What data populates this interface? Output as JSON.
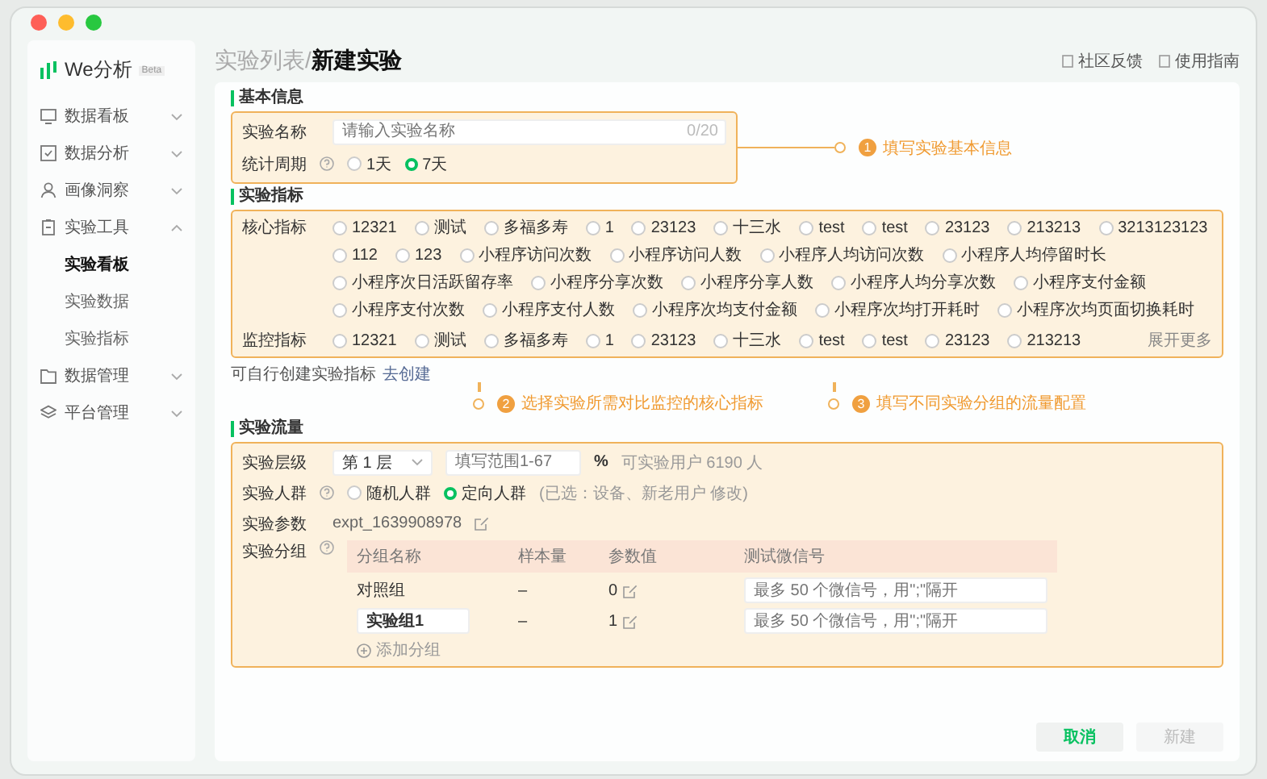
{
  "sidebar": {
    "logo": "We分析",
    "badge": "Beta",
    "items": [
      {
        "label": "数据看板",
        "expanded": false
      },
      {
        "label": "数据分析",
        "expanded": false
      },
      {
        "label": "画像洞察",
        "expanded": false
      },
      {
        "label": "实验工具",
        "expanded": true,
        "children": [
          {
            "label": "实验看板",
            "selected": true
          },
          {
            "label": "实验数据",
            "selected": false
          },
          {
            "label": "实验指标",
            "selected": false
          }
        ]
      },
      {
        "label": "数据管理",
        "expanded": false
      },
      {
        "label": "平台管理",
        "expanded": false
      }
    ]
  },
  "breadcrumb": {
    "parent": "实验列表/",
    "current": "新建实验"
  },
  "header_links": [
    "社区反馈",
    "使用指南"
  ],
  "basic_info": {
    "heading": "基本信息",
    "name": {
      "label": "实验名称",
      "placeholder": "请输入实验名称",
      "counter": "0/20"
    },
    "period": {
      "label": "统计周期",
      "options": [
        {
          "label": "1天",
          "selected": false
        },
        {
          "label": "7天",
          "selected": true
        }
      ]
    },
    "callout": {
      "number": "1",
      "text": "填写实验基本信息"
    }
  },
  "metrics": {
    "heading": "实验指标",
    "core": {
      "label": "核心指标",
      "options": [
        {
          "label": "12321",
          "checked": false
        },
        {
          "label": "测试",
          "checked": false
        },
        {
          "label": "多福多寿",
          "checked": false
        },
        {
          "label": "1",
          "checked": false
        },
        {
          "label": "23123",
          "checked": false
        },
        {
          "label": "十三水",
          "checked": false
        },
        {
          "label": "test",
          "checked": false
        },
        {
          "label": "test",
          "checked": false
        },
        {
          "label": "23123",
          "checked": false
        },
        {
          "label": "213213",
          "checked": false
        },
        {
          "label": "3213123123",
          "checked": false
        },
        {
          "label": "112",
          "checked": false
        },
        {
          "label": "123",
          "checked": false
        },
        {
          "label": "小程序访问次数",
          "checked": false
        },
        {
          "label": "小程序访问人数",
          "checked": false
        },
        {
          "label": "小程序人均访问次数",
          "checked": false
        },
        {
          "label": "小程序人均停留时长",
          "checked": false
        },
        {
          "label": "小程序次日活跃留存率",
          "checked": false
        },
        {
          "label": "小程序分享次数",
          "checked": false
        },
        {
          "label": "小程序分享人数",
          "checked": false
        },
        {
          "label": "小程序人均分享次数",
          "checked": false
        },
        {
          "label": "小程序支付金额",
          "checked": false
        },
        {
          "label": "小程序支付次数",
          "checked": false
        },
        {
          "label": "小程序支付人数",
          "checked": false
        },
        {
          "label": "小程序次均支付金额",
          "checked": false
        },
        {
          "label": "小程序次均打开耗时",
          "checked": false
        },
        {
          "label": "小程序次均页面切换耗时",
          "checked": false
        }
      ]
    },
    "monitor": {
      "label": "监控指标",
      "options": [
        {
          "label": "12321",
          "checked": false
        },
        {
          "label": "测试",
          "checked": false
        },
        {
          "label": "多福多寿",
          "checked": false
        },
        {
          "label": "1",
          "checked": false
        },
        {
          "label": "23123",
          "checked": false
        },
        {
          "label": "十三水",
          "checked": false
        },
        {
          "label": "test",
          "checked": false
        },
        {
          "label": "test",
          "checked": false
        },
        {
          "label": "23123",
          "checked": false
        },
        {
          "label": "213213",
          "checked": false
        }
      ],
      "more": "展开更多"
    },
    "hint": "可自行创建实验指标",
    "link": "去创建"
  },
  "callouts": [
    {
      "number": "2",
      "text": "选择实验所需对比监控的核心指标"
    },
    {
      "number": "3",
      "text": "填写不同实验分组的流量配置"
    }
  ],
  "traffic": {
    "heading": "实验流量",
    "level": {
      "label": "实验层级",
      "select": "第 1 层",
      "placeholder": "填写范围1-67",
      "unit": "%",
      "note": "可实验用户 6190 人"
    },
    "crowd": {
      "label": "实验人群",
      "options": [
        {
          "label": "随机人群",
          "selected": false
        },
        {
          "label": "定向人群",
          "selected": true
        }
      ],
      "note": "(已选：设备、新老用户 修改)"
    },
    "param": {
      "label": "实验参数",
      "value": "expt_1639908978"
    },
    "groups": {
      "label": "实验分组",
      "columns": [
        "分组名称",
        "样本量",
        "参数值",
        "测试微信号"
      ],
      "rows": [
        {
          "kind": "text",
          "name": "对照组",
          "sample": "–",
          "param": "0",
          "placeholder": "最多 50 个微信号，用\";\"隔开"
        },
        {
          "kind": "input",
          "name": "实验组1",
          "sample": "–",
          "param": "1",
          "placeholder": "最多 50 个微信号，用\";\"隔开"
        }
      ],
      "add": "添加分组"
    }
  },
  "buttons": [
    {
      "label": "取消",
      "disabled": false
    },
    {
      "label": "新建",
      "disabled": true
    }
  ]
}
